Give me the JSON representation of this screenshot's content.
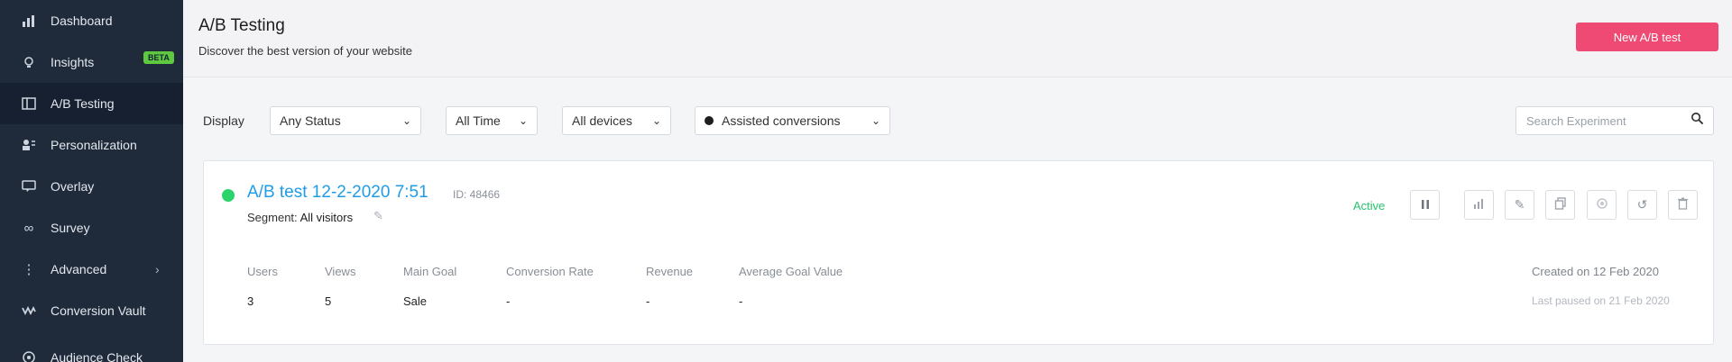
{
  "sidebar": {
    "items": [
      {
        "label": "Dashboard",
        "icon": "bar-chart-icon"
      },
      {
        "label": "Insights",
        "icon": "lightbulb-icon",
        "badge": "BETA"
      },
      {
        "label": "A/B Testing",
        "icon": "split-layout-icon",
        "active": true
      },
      {
        "label": "Personalization",
        "icon": "user-settings-icon"
      },
      {
        "label": "Overlay",
        "icon": "speech-bubble-icon"
      },
      {
        "label": "Survey",
        "icon": "infinity-icon"
      },
      {
        "label": "Advanced",
        "icon": "vertical-dots-icon",
        "expandable": true
      },
      {
        "label": "Conversion Vault",
        "icon": "zigzag-icon"
      },
      {
        "label": "Audience Check",
        "icon": "target-icon"
      }
    ]
  },
  "header": {
    "title": "A/B Testing",
    "subtitle": "Discover the best version of your website",
    "new_button": "New A/B test"
  },
  "filters": {
    "display_label": "Display",
    "status": "Any Status",
    "time": "All Time",
    "devices": "All devices",
    "metric": "Assisted conversions",
    "search_placeholder": "Search Experiment"
  },
  "experiment": {
    "name": "A/B test 12-2-2020 7:51",
    "id": "ID: 48466",
    "segment_prefix": "Segment:",
    "segment_value": "All visitors",
    "status": "Active",
    "status_color": "#2bd46b",
    "actions": [
      "pause-icon",
      "report-chart-icon",
      "edit-pencil-icon",
      "duplicate-icon",
      "settings-gear-icon",
      "reset-icon",
      "trash-icon"
    ],
    "metric_headers": [
      "Users",
      "Views",
      "Main Goal",
      "Conversion Rate",
      "Revenue",
      "Average Goal Value"
    ],
    "metric_values": [
      "3",
      "5",
      "Sale",
      "-",
      "-",
      "-"
    ],
    "created": "Created on 12 Feb 2020",
    "last_paused": "Last paused on 21 Feb 2020"
  },
  "colors": {
    "sidebar_bg": "#1f2a3b",
    "accent_pink": "#ef4a73",
    "link_blue": "#1e9de6",
    "active_green": "#27c56b"
  }
}
